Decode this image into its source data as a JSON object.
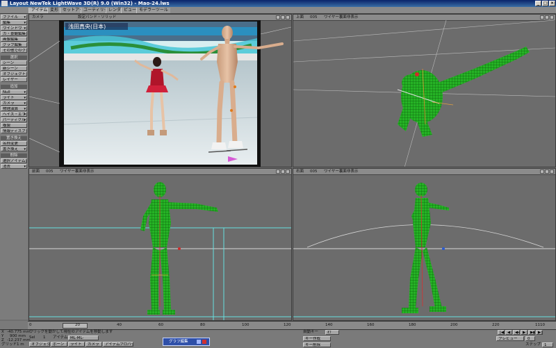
{
  "window": {
    "title": "Layout NewTek LightWave 3D(R) 9.0 (Win32) - Mao-24.lws",
    "min": "_",
    "max": "□",
    "close": "×"
  },
  "tabs": [
    "アイテム",
    "変形",
    "セットアップ",
    "ユーティリティ",
    "レンダー",
    "ビュー",
    "モデラーツール"
  ],
  "sidebar": {
    "top_items": [
      "ファイル",
      "編集",
      "ウインドウ",
      "カ・景観編集",
      "画像編集",
      "グラフ編集",
      "その他でのクリック"
    ],
    "section_view": "選択",
    "view_items": [
      "シーン",
      "新シーン",
      "オブジェクト",
      "レイヤー"
    ],
    "section_add": "追加",
    "add_items": [
      "Null",
      "ライト",
      "カメラ",
      "物理演算",
      "ヘイズ・エフェクト",
      "パーティクル",
      "複製",
      "情報ディスプレイ"
    ],
    "section_replace": "置き換え",
    "replace_items": [
      "名称変更",
      "置き換え"
    ],
    "section_delete": "削除",
    "delete_items": [
      "選択アイテム消去",
      "消去"
    ]
  },
  "viewports": {
    "camera": {
      "label": "カメラ",
      "mode": "設定バンド・ソリッド"
    },
    "top": {
      "label": "上面",
      "zoom": "005",
      "mode": "ワイヤー裏面非表示"
    },
    "front": {
      "label": "前面",
      "zoom": "005",
      "mode": "ワイヤー裏面非表示"
    },
    "right": {
      "label": "右面",
      "zoom": "005",
      "mode": "ワイヤー裏面非表示"
    }
  },
  "overlay": {
    "caption": "浅田真央(日本)"
  },
  "timeline": {
    "ticks": [
      "0",
      "20",
      "40",
      "60",
      "80",
      "100",
      "120",
      "140",
      "160",
      "180",
      "200",
      "220"
    ],
    "end": "1110"
  },
  "bottom": {
    "x_label": "X",
    "x_value": "-40.775 mm",
    "y_label": "Y",
    "y_value": "900 mm",
    "z_label": "Z",
    "z_value": "-12.237 mm",
    "grid_label": "グリッド",
    "grid_value": "1 m",
    "status": "ウリックを動かして現在のアイテムを移動します",
    "sel_label": "Sel",
    "sel_value": "1",
    "item_label": "アイテム",
    "item_value": "ML-ML-",
    "buttons": [
      "オブジェクト",
      "ボーン",
      "ライト",
      "カメラ",
      "アイテムプロパティ"
    ],
    "graph_button": "グラフ編集",
    "auto_key": "自動キー",
    "auto_key_value": "ｵﾌ",
    "create_key": "キー作成",
    "delete_key": "キー削除",
    "preview": "プレビュー",
    "step_label": "ステップ",
    "step_value": "1",
    "frame_value": "0"
  },
  "colors": {
    "mesh": "#25b325",
    "mesh_dark": "#0e7a0e",
    "grid_line": "#66e0e0"
  }
}
